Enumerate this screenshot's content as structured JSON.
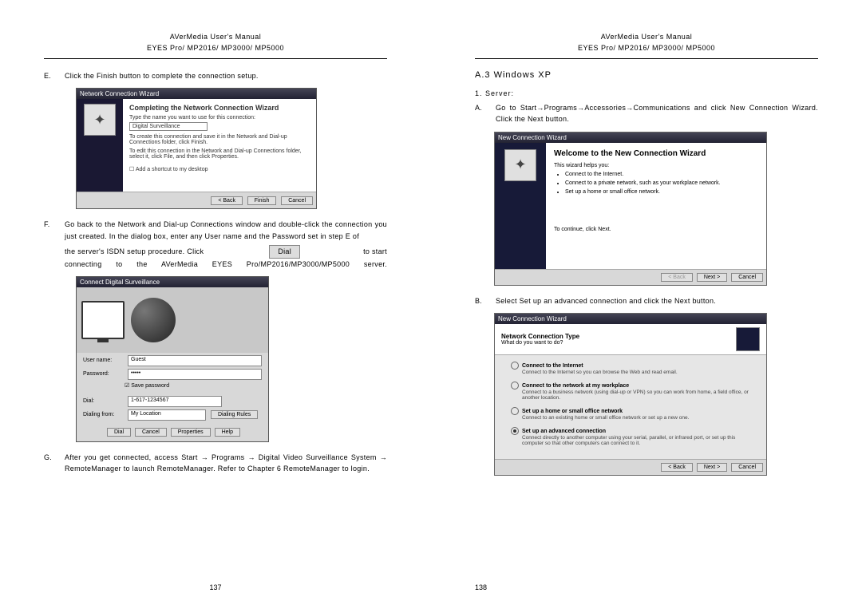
{
  "leftPage": {
    "header1": "AVerMedia User's Manual",
    "header2": "EYES Pro/ MP2016/ MP3000/ MP5000",
    "E": "Click the Finish button to complete the connection setup.",
    "wiz1": {
      "title": "Network Connection Wizard",
      "heading": "Completing the Network Connection Wizard",
      "sub1": "Type the name you want to use for this connection:",
      "field": "Digital Surveillance",
      "sub2": "To create this connection and save it in the Network and Dial-up Connections folder, click Finish.",
      "sub3": "To edit this connection in the Network and Dial-up Connections folder, select it, click File, and then click Properties.",
      "chk": "Add a shortcut to my desktop",
      "back": "< Back",
      "finish": "Finish",
      "cancel": "Cancel"
    },
    "F1": "Go back to the Network and Dial-up Connections window and double-click the connection you just created.  In the dialog box, enter any User name and the Password set in step E of",
    "F2a": "the server's ISDN setup procedure.  Click",
    "F2b": "to start",
    "dialBtn": "Dial",
    "F3": "connecting to the AVerMedia EYES Pro/MP2016/MP3000/MP5000 server.",
    "dlg2": {
      "title": "Connect Digital Surveillance",
      "userLbl": "User name:",
      "userVal": "Guest",
      "passLbl": "Password:",
      "save": "Save password",
      "dialLbl": "Dial:",
      "dialVal": "1-617-1234567",
      "fromLbl": "Dialing from:",
      "fromVal": "My Location",
      "rules": "Dialing Rules",
      "btnDial": "Dial",
      "btnCancel": "Cancel",
      "btnProp": "Properties",
      "btnHelp": "Help"
    },
    "G": "After you get connected, access Start → Programs → Digital Video Surveillance System → RemoteManager to launch RemoteManager.  Refer to Chapter 6 RemoteManager to login.",
    "pagenum": "137"
  },
  "rightPage": {
    "header1": "AVerMedia User's Manual",
    "header2": "EYES Pro/ MP2016/ MP3000/ MP5000",
    "section": "A.3  Windows XP",
    "sub1": "1.  Server:",
    "A": "Go to Start→Programs→Accessories→Communications and click New Connection Wizard.  Click the Next button.",
    "xp1": {
      "title": "New Connection Wizard",
      "heading": "Welcome to the New Connection Wizard",
      "sub": "This wizard helps you:",
      "li1": "Connect to the Internet.",
      "li2": "Connect to a private network, such as your workplace network.",
      "li3": "Set up a home or small office network.",
      "cont": "To continue, click Next.",
      "back": "< Back",
      "next": "Next >",
      "cancel": "Cancel"
    },
    "B": "Select Set up an advanced connection and click the Next button.",
    "xp2": {
      "title": "New Connection Wizard",
      "hdrTitle": "Network Connection Type",
      "hdrSub": "What do you want to do?",
      "o1t": "Connect to the Internet",
      "o1d": "Connect to the Internet so you can browse the Web and read email.",
      "o2t": "Connect to the network at my workplace",
      "o2d": "Connect to a business network (using dial-up or VPN) so you can work from home, a field office, or another location.",
      "o3t": "Set up a home or small office network",
      "o3d": "Connect to an existing home or small office network or set up a new one.",
      "o4t": "Set up an advanced connection",
      "o4d": "Connect directly to another computer using your serial, parallel, or infrared port, or set up this computer so that other computers can connect to it.",
      "back": "< Back",
      "next": "Next >",
      "cancel": "Cancel"
    },
    "pagenum": "138"
  }
}
